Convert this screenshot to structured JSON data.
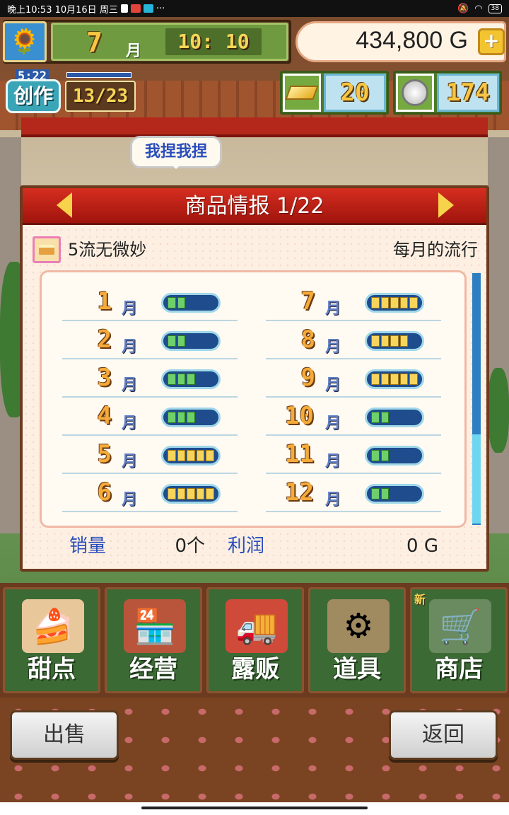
{
  "status_bar": {
    "left_text": "晚上10:53 10月16日 周三",
    "ellipsis": "···",
    "battery": "38"
  },
  "hud": {
    "month": "7",
    "month_unit": "月",
    "time": "10: 10",
    "money": "434,800 G",
    "plus": "+",
    "create_timer": "5:22",
    "create_label": "创作",
    "create_count": "13/23",
    "gold_count": "20",
    "coin_count": "174",
    "icons": [
      "sunflower-avatar",
      "gold-bar-icon",
      "silver-coin-icon"
    ]
  },
  "speech_bubble": "我捏我捏",
  "dialog": {
    "title": "商品情报 1/22",
    "item_name": "5流无微妙",
    "trend_label": "每月的流行",
    "months_left": [
      {
        "num": "1",
        "unit": "月",
        "level": 2,
        "color": "green"
      },
      {
        "num": "2",
        "unit": "月",
        "level": 2,
        "color": "green"
      },
      {
        "num": "3",
        "unit": "月",
        "level": 3,
        "color": "green"
      },
      {
        "num": "4",
        "unit": "月",
        "level": 3,
        "color": "green"
      },
      {
        "num": "5",
        "unit": "月",
        "level": 5,
        "color": "yellow"
      },
      {
        "num": "6",
        "unit": "月",
        "level": 5,
        "color": "yellow"
      }
    ],
    "months_right": [
      {
        "num": "7",
        "unit": "月",
        "level": 5,
        "color": "yellow"
      },
      {
        "num": "8",
        "unit": "月",
        "level": 4,
        "color": "yellow"
      },
      {
        "num": "9",
        "unit": "月",
        "level": 5,
        "color": "yellow"
      },
      {
        "num": "10",
        "unit": "月",
        "level": 2,
        "color": "green"
      },
      {
        "num": "11",
        "unit": "月",
        "level": 2,
        "color": "green"
      },
      {
        "num": "12",
        "unit": "月",
        "level": 2,
        "color": "green"
      }
    ],
    "sales_label": "销量",
    "sales_value": "0个",
    "profit_label": "利润",
    "profit_value": "0 G"
  },
  "menu": {
    "items": [
      {
        "label": "甜点",
        "icon": "cake-icon"
      },
      {
        "label": "经营",
        "icon": "shop-icon"
      },
      {
        "label": "露贩",
        "icon": "food-truck-icon"
      },
      {
        "label": "道具",
        "icon": "gear-bag-icon"
      },
      {
        "label": "商店",
        "icon": "shopping-cart-icon"
      }
    ],
    "new_tag": "新"
  },
  "footer": {
    "sell_label": "出售",
    "back_label": "返回"
  },
  "colors": {
    "header_red": "#c11f14",
    "menu_green": "#3c6a35",
    "label_blue": "#2a4dbb",
    "bar_green": "#6ed06a",
    "bar_yellow": "#f7d55b"
  }
}
